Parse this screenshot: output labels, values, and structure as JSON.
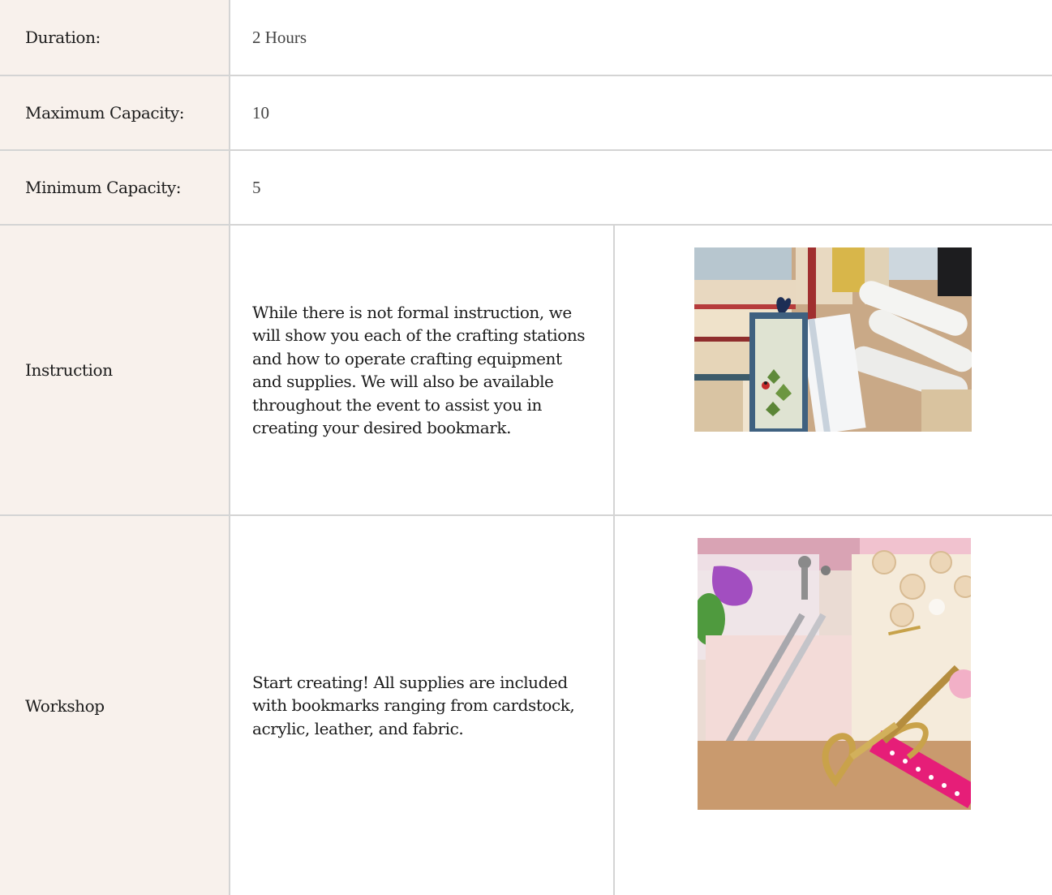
{
  "rows": [
    {
      "label": "Duration:",
      "value": "2 Hours"
    },
    {
      "label": "Maximum Capacity:",
      "value": "10"
    },
    {
      "label": "Minimum Capacity:",
      "value": "5"
    },
    {
      "label": "Instruction",
      "description": "While there is not formal instruction, we will show you each of the crafting stations and how to operate crafting equipment and supplies. We will also be available throughout the event to assist you in creating your desired bookmark.",
      "image": "bookmark-on-books-photo"
    },
    {
      "label": "Workshop",
      "description": "Start creating! All supplies are included with bookmarks ranging from cardstock, acrylic, leather, and fabric.",
      "image": "craft-supplies-photo"
    }
  ],
  "colors": {
    "label_bg": "#f8f1ec",
    "border": "#d4d4d4",
    "text": "#1b1b1b",
    "value_text": "#444444"
  }
}
